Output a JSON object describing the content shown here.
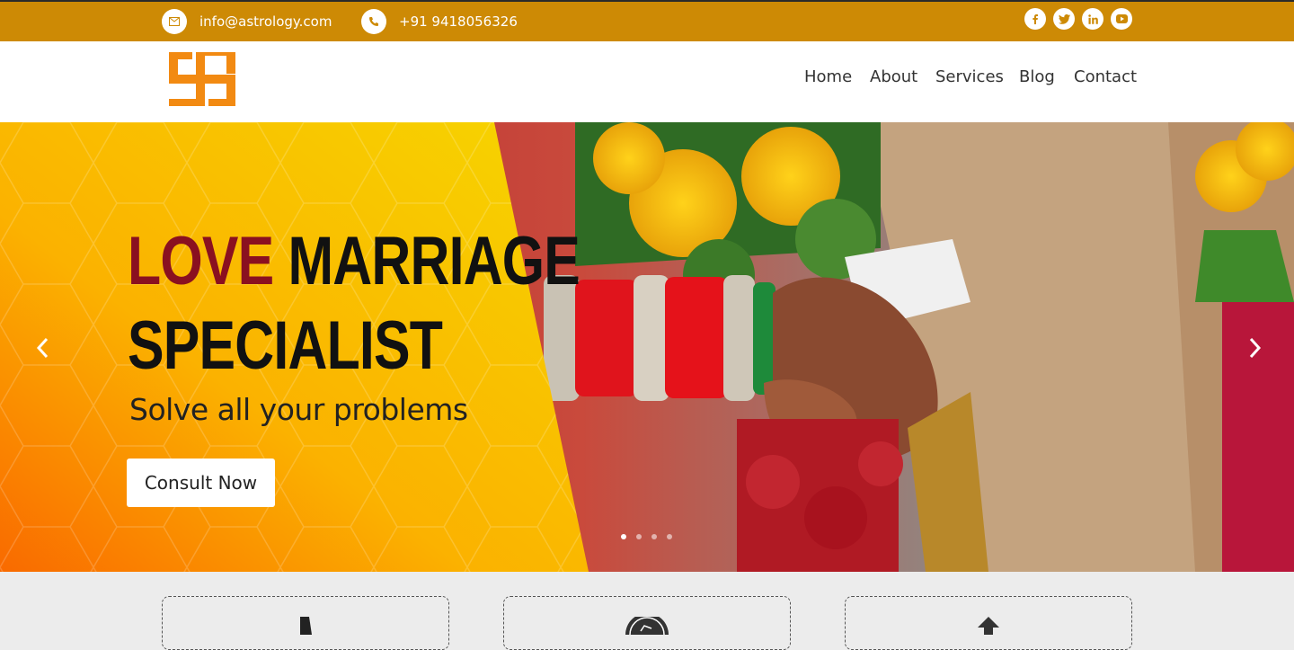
{
  "topbar": {
    "email": "info@astrology.com",
    "phone": "+91 9418056326",
    "email_icon": "mail-icon",
    "phone_icon": "phone-icon",
    "social": [
      "facebook-icon",
      "twitter-icon",
      "linkedin-icon",
      "youtube-icon"
    ],
    "bg_color": "#cd8a05"
  },
  "nav": {
    "logo_icon": "swastika-logo",
    "items": [
      "Home",
      "About",
      "Services",
      "Blog",
      "Contact"
    ]
  },
  "hero": {
    "headline_word1": "LOVE",
    "headline_word2": "MARRIAGE",
    "headline_line2": "SPECIALIST",
    "subtitle": "Solve all your problems",
    "cta": "Consult Now",
    "slide_index": 1,
    "slide_count": 4,
    "accent_color": "#8a1020",
    "yellow": "#f5c400"
  },
  "cards": {
    "icons": [
      "mobile-phone-icon",
      "clock-badge-icon",
      "up-arrow-icon"
    ]
  }
}
